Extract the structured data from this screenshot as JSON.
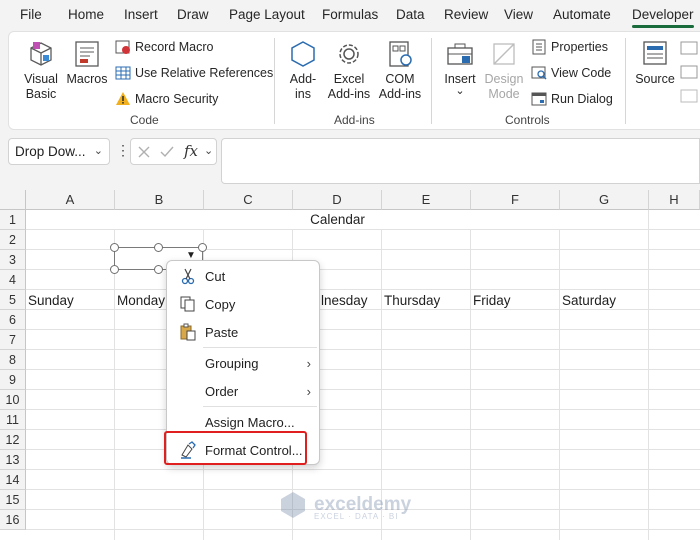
{
  "tabs": [
    "File",
    "Home",
    "Insert",
    "Draw",
    "Page Layout",
    "Formulas",
    "Data",
    "Review",
    "View",
    "Automate",
    "Developer"
  ],
  "active_tab": "Developer",
  "ribbon": {
    "code": {
      "visual_basic": [
        "Visual",
        "Basic"
      ],
      "macros": "Macros",
      "record_macro": "Record Macro",
      "relative_refs": "Use Relative References",
      "macro_security": "Macro Security",
      "group_label": "Code"
    },
    "addins": {
      "addins": [
        "Add-",
        "ins"
      ],
      "excel_addins": [
        "Excel",
        "Add-ins"
      ],
      "com_addins": [
        "COM",
        "Add-ins"
      ],
      "group_label": "Add-ins"
    },
    "controls": {
      "insert": "Insert",
      "insert_chevron": "⌄",
      "design_mode": [
        "Design",
        "Mode"
      ],
      "properties": "Properties",
      "view_code": "View Code",
      "run_dialog": "Run Dialog",
      "group_label": "Controls"
    },
    "xml": {
      "source": "Source"
    }
  },
  "formula_bar": {
    "name_box": "Drop Dow...",
    "formula": ""
  },
  "grid": {
    "columns": [
      "A",
      "B",
      "C",
      "D",
      "E",
      "F",
      "G",
      "H"
    ],
    "rows": [
      "1",
      "2",
      "3",
      "4",
      "5",
      "6",
      "7",
      "8",
      "9",
      "10",
      "11",
      "12",
      "13",
      "14",
      "15",
      "16"
    ],
    "cells": {
      "calendar_title": "Calendar",
      "sunday": "Sunday",
      "monday": "Monday",
      "wednesday_partial": "lnesday",
      "thursday": "Thursday",
      "friday": "Friday",
      "saturday": "Saturday"
    }
  },
  "context_menu": {
    "cut": "Cut",
    "copy": "Copy",
    "paste": "Paste",
    "grouping": "Grouping",
    "order": "Order",
    "assign_macro": "Assign Macro...",
    "format_control": "Format Control..."
  },
  "watermark": {
    "name": "exceldemy",
    "tagline": "EXCEL · DATA · BI"
  },
  "colors": {
    "accent": "#1a6b3c",
    "highlight": "#e0201f"
  }
}
